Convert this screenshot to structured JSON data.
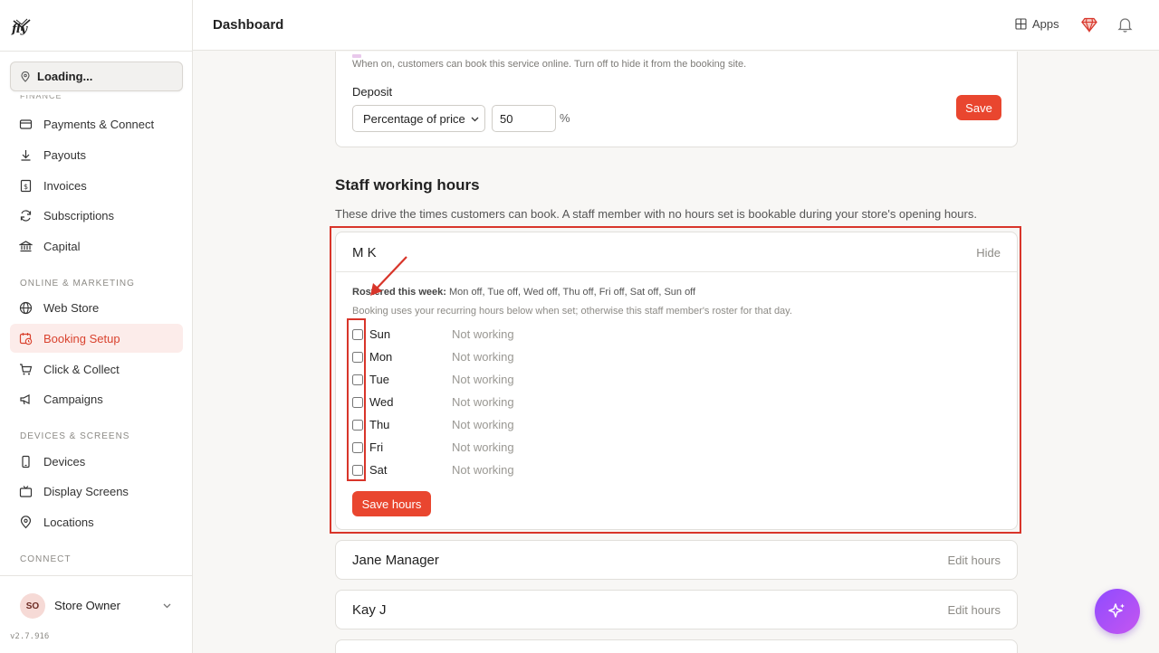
{
  "sidebar": {
    "logo_text": "fly",
    "location": "Loading...",
    "finance_label_cut": "FINANCE",
    "items_finance": [
      {
        "label": "Payments & Connect",
        "icon": "card-icon"
      },
      {
        "label": "Payouts",
        "icon": "download-icon"
      },
      {
        "label": "Invoices",
        "icon": "invoice-icon"
      },
      {
        "label": "Subscriptions",
        "icon": "refresh-icon"
      },
      {
        "label": "Capital",
        "icon": "bank-icon"
      }
    ],
    "section_online": "ONLINE & MARKETING",
    "items_online": [
      {
        "label": "Web Store",
        "icon": "globe-icon"
      },
      {
        "label": "Booking Setup",
        "icon": "calendar-clock-icon",
        "active": true
      },
      {
        "label": "Click & Collect",
        "icon": "cart-icon"
      },
      {
        "label": "Campaigns",
        "icon": "megaphone-icon"
      }
    ],
    "section_devices": "DEVICES & SCREENS",
    "items_devices": [
      {
        "label": "Devices",
        "icon": "phone-icon"
      },
      {
        "label": "Display Screens",
        "icon": "display-icon"
      },
      {
        "label": "Locations",
        "icon": "pin-icon"
      }
    ],
    "section_connect": "CONNECT",
    "user": {
      "initials": "SO",
      "name": "Store Owner"
    },
    "version": "v2.7.916"
  },
  "header": {
    "title": "Dashboard",
    "apps_label": "Apps"
  },
  "deposit": {
    "online_help": "When on, customers can book this service online. Turn off to hide it from the booking site.",
    "label": "Deposit",
    "type_selected": "Percentage of price",
    "value": "50",
    "unit": "%",
    "save_label": "Save"
  },
  "staff": {
    "title": "Staff working hours",
    "description": "These drive the times customers can book. A staff member with no hours set is bookable during your store's opening hours.",
    "expanded": {
      "name": "M K",
      "hide_label": "Hide",
      "rostered_label": "Rostered this week:",
      "rostered_value": "Mon off, Tue off, Wed off, Thu off, Fri off, Sat off, Sun off",
      "note": "Booking uses your recurring hours below when set; otherwise this staff member's roster for that day.",
      "days": [
        {
          "day": "Sun",
          "status": "Not working"
        },
        {
          "day": "Mon",
          "status": "Not working"
        },
        {
          "day": "Tue",
          "status": "Not working"
        },
        {
          "day": "Wed",
          "status": "Not working"
        },
        {
          "day": "Thu",
          "status": "Not working"
        },
        {
          "day": "Fri",
          "status": "Not working"
        },
        {
          "day": "Sat",
          "status": "Not working"
        }
      ],
      "save_hours_label": "Save hours"
    },
    "others": [
      {
        "name": "Jane Manager",
        "action": "Edit hours"
      },
      {
        "name": "Kay J",
        "action": "Edit hours"
      }
    ]
  },
  "colors": {
    "accent": "#e9462f",
    "active_bg": "#fcecea",
    "annotation": "#d8352a",
    "fab_gradient_start": "#8f4bff"
  }
}
